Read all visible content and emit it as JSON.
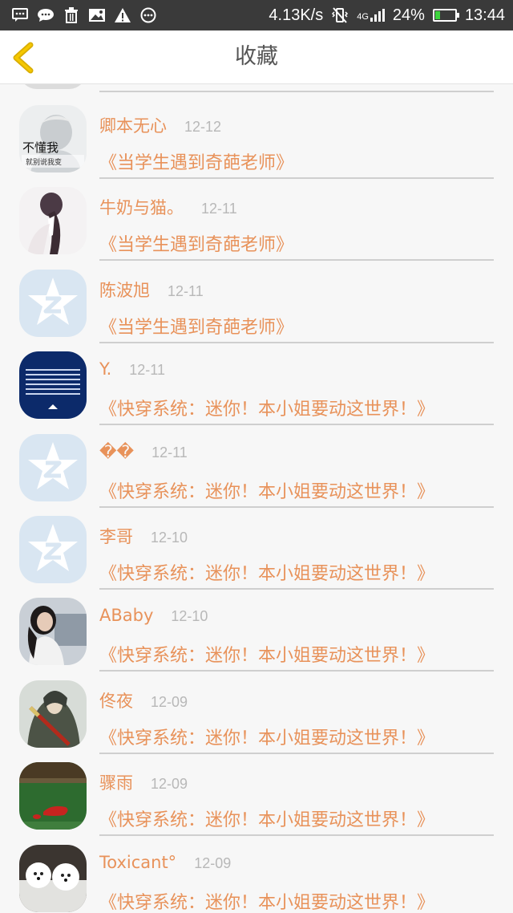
{
  "status_bar": {
    "network_speed": "4.13K/s",
    "network_type": "4G",
    "battery_percent": "24%",
    "battery_level": 0.24,
    "time": "13:44",
    "left_icons": [
      "message-icon",
      "chat-bubble-icon",
      "trash-icon",
      "image-icon",
      "warning-icon",
      "more-dots-icon"
    ]
  },
  "header": {
    "title": "收藏",
    "back_icon": "chevron-left-icon",
    "accent_color": "#f2c200"
  },
  "list": {
    "name_color": "#e8925a",
    "date_color": "#b8b8b8",
    "items": [
      {
        "name": "卿本无心",
        "date": "12-12",
        "title": "《当学生遇到奇葩老师》",
        "avatar": "photo-avatar",
        "avatar_text": "不懂我 就别说我变"
      },
      {
        "name": "牛奶与猫。",
        "date": "12-11",
        "title": "《当学生遇到奇葩老师》",
        "avatar": "photo-avatar"
      },
      {
        "name": "陈波旭",
        "date": "12-11",
        "title": "《当学生遇到奇葩老师》",
        "avatar": "default-star-avatar"
      },
      {
        "name": "Y.",
        "date": "12-11",
        "title": "《快穿系统：迷你！本小姐要动这世界！》",
        "avatar": "photo-avatar"
      },
      {
        "name": "��",
        "date": "12-11",
        "title": "《快穿系统：迷你！本小姐要动这世界！》",
        "avatar": "default-star-avatar"
      },
      {
        "name": "李哥",
        "date": "12-10",
        "title": "《快穿系统：迷你！本小姐要动这世界！》",
        "avatar": "default-star-avatar"
      },
      {
        "name": "ABaby",
        "date": "12-10",
        "title": "《快穿系统：迷你！本小姐要动这世界！》",
        "avatar": "photo-avatar"
      },
      {
        "name": "佟夜",
        "date": "12-09",
        "title": "《快穿系统：迷你！本小姐要动这世界！》",
        "avatar": "photo-avatar"
      },
      {
        "name": "骤雨",
        "date": "12-09",
        "title": "《快穿系统：迷你！本小姐要动这世界！》",
        "avatar": "photo-avatar"
      },
      {
        "name": "Toxicant°",
        "date": "12-09",
        "title": "《快穿系统：迷你！本小姐要动这世界！》",
        "avatar": "photo-avatar"
      }
    ]
  }
}
